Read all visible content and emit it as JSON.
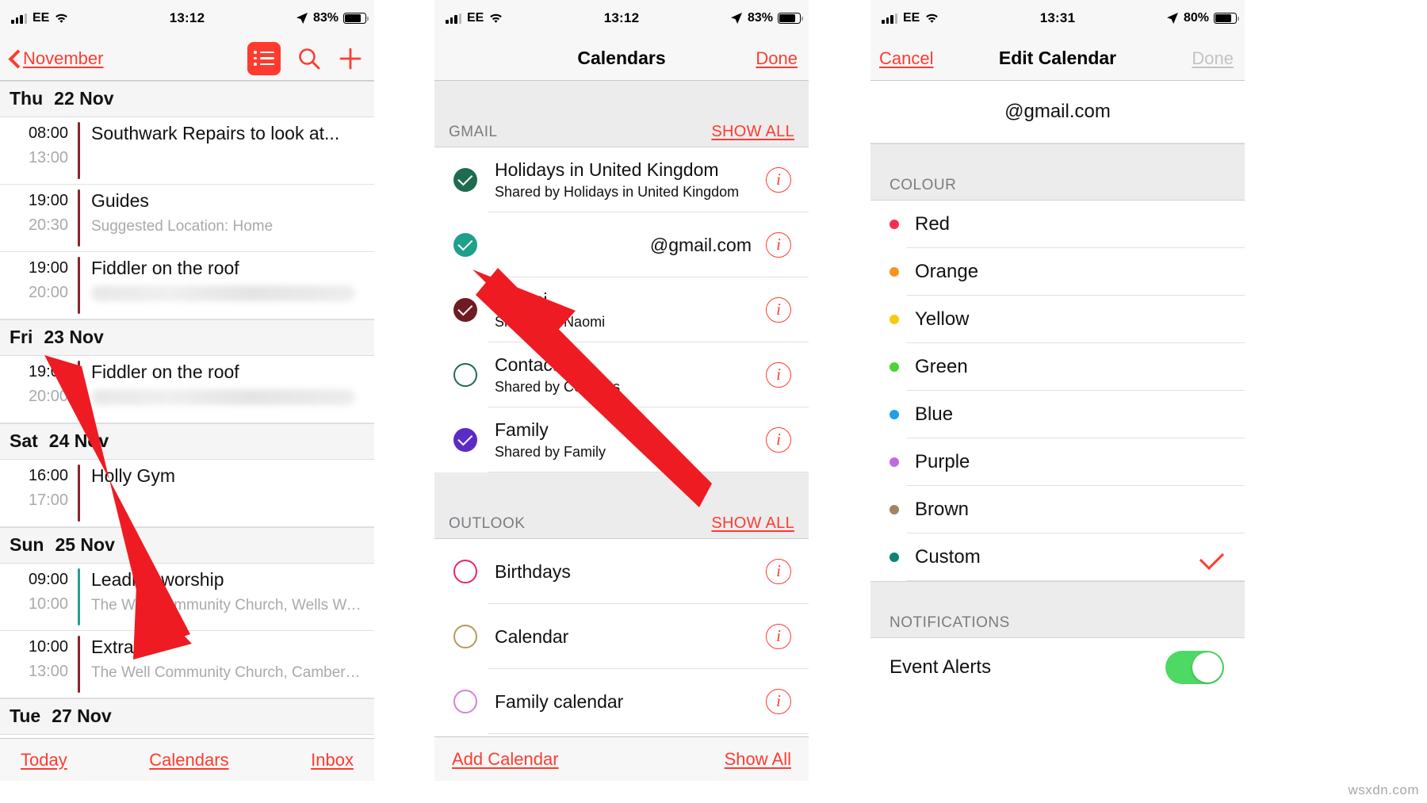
{
  "panels": {
    "agenda": {
      "status": {
        "carrier": "EE",
        "time": "13:12",
        "battery": "83%"
      },
      "nav": {
        "back_label": "November",
        "list_icon": "list-view-icon",
        "search_icon": "search-icon",
        "add_icon": "plus-icon"
      },
      "days": [
        {
          "weekday": "Thu",
          "date": "22 Nov",
          "events": [
            {
              "start": "08:00",
              "end": "13:00",
              "title": "Southwark Repairs to look at...",
              "subtitle": "",
              "blurred": false,
              "color": "#8a2430"
            },
            {
              "start": "19:00",
              "end": "20:30",
              "title": "Guides",
              "subtitle": "Suggested Location: Home",
              "blurred": false,
              "color": "#8a2430"
            },
            {
              "start": "19:00",
              "end": "20:00",
              "title": "Fiddler on the roof",
              "subtitle": "",
              "blurred": true,
              "color": "#8a2430"
            }
          ]
        },
        {
          "weekday": "Fri",
          "date": "23 Nov",
          "events": [
            {
              "start": "19:00",
              "end": "20:00",
              "title": "Fiddler on the roof",
              "subtitle": "",
              "blurred": true,
              "color": "#8a2430"
            }
          ]
        },
        {
          "weekday": "Sat",
          "date": "24 Nov",
          "events": [
            {
              "start": "16:00",
              "end": "17:00",
              "title": "Holly Gym",
              "subtitle": "",
              "blurred": false,
              "color": "#8a2430"
            }
          ]
        },
        {
          "weekday": "Sun",
          "date": "25 Nov",
          "events": [
            {
              "start": "09:00",
              "end": "10:00",
              "title": "Leading worship",
              "subtitle": "The Well Community Church, Wells Wa...",
              "blurred": false,
              "color": "#2a9d8f"
            },
            {
              "start": "10:00",
              "end": "13:00",
              "title": "Extra",
              "subtitle": "The Well Community Church, Camberw...",
              "blurred": false,
              "color": "#8a2430"
            }
          ]
        },
        {
          "weekday": "Tue",
          "date": "27 Nov",
          "events": []
        }
      ],
      "toolbar": {
        "today": "Today",
        "calendars": "Calendars",
        "inbox": "Inbox"
      }
    },
    "calendars": {
      "status": {
        "carrier": "EE",
        "time": "13:12",
        "battery": "83%"
      },
      "nav": {
        "title": "Calendars",
        "done": "Done"
      },
      "sections": [
        {
          "label": "GMAIL",
          "show_all": "SHOW ALL",
          "items": [
            {
              "name": "Holidays in United Kingdom",
              "shared": "Shared by Holidays in United Kingdom",
              "checked": true,
              "color": "#1e6b4f",
              "align": "left",
              "info": "info-icon"
            },
            {
              "name": "@gmail.com",
              "shared": "",
              "checked": true,
              "color": "#1fa08a",
              "align": "right",
              "info": "info-icon"
            },
            {
              "name": "Naomi",
              "shared": "Shared by Naomi",
              "checked": true,
              "color": "#6e1b22",
              "align": "left",
              "info": "info-icon"
            },
            {
              "name": "Contacts",
              "shared": "Shared by Contacts",
              "checked": false,
              "color": "#1e6b4f",
              "align": "left",
              "info": "info-icon"
            },
            {
              "name": "Family",
              "shared": "Shared by Family",
              "checked": true,
              "color": "#5b2bc4",
              "align": "left",
              "info": "info-icon"
            }
          ]
        },
        {
          "label": "OUTLOOK",
          "show_all": "SHOW ALL",
          "items": [
            {
              "name": "Birthdays",
              "shared": "",
              "checked": false,
              "color": "#e8256a",
              "align": "left",
              "info": "info-icon"
            },
            {
              "name": "Calendar",
              "shared": "",
              "checked": false,
              "color": "#b49a5e",
              "align": "left",
              "info": "info-icon"
            },
            {
              "name": "Family calendar",
              "shared": "",
              "checked": false,
              "color": "#d97fe0",
              "align": "left",
              "info": "info-icon"
            }
          ]
        }
      ],
      "bottom": {
        "add_calendar": "Add Calendar",
        "show_all": "Show All"
      }
    },
    "edit_calendar": {
      "status": {
        "carrier": "EE",
        "time": "13:31",
        "battery": "80%"
      },
      "nav": {
        "cancel": "Cancel",
        "title": "Edit Calendar",
        "done": "Done"
      },
      "account": "@gmail.com",
      "colour_header": "COLOUR",
      "colours": [
        {
          "name": "Red",
          "hex": "#fa2d55",
          "selected": false
        },
        {
          "name": "Orange",
          "hex": "#f8931f",
          "selected": false
        },
        {
          "name": "Yellow",
          "hex": "#fdc80c",
          "selected": false
        },
        {
          "name": "Green",
          "hex": "#4cd435",
          "selected": false
        },
        {
          "name": "Blue",
          "hex": "#1fa0e8",
          "selected": false
        },
        {
          "name": "Purple",
          "hex": "#c46ae0",
          "selected": false
        },
        {
          "name": "Brown",
          "hex": "#a3845e",
          "selected": false
        },
        {
          "name": "Custom",
          "hex": "#0f8277",
          "selected": true
        }
      ],
      "notifications_header": "NOTIFICATIONS",
      "event_alerts": {
        "label": "Event Alerts",
        "enabled": true
      }
    }
  },
  "watermark": "wsxdn.com"
}
